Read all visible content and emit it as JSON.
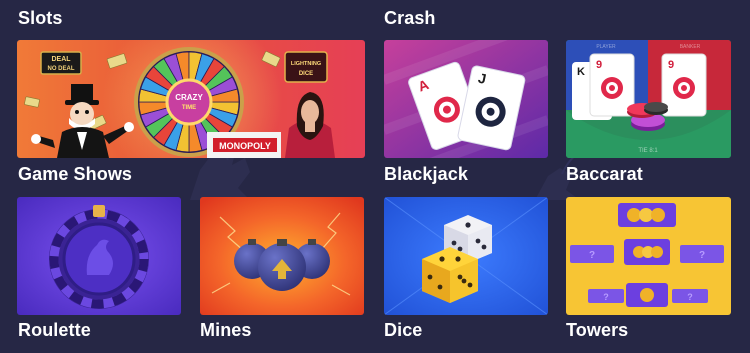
{
  "sections": {
    "slots": "Slots",
    "crash": "Crash"
  },
  "games": [
    {
      "key": "game-shows",
      "label": "Game Shows",
      "logo_deal": "DEAL",
      "logo_no_deal": "NO DEAL",
      "logo_crazy": "CRAZY",
      "logo_time": "TIME",
      "logo_lightning": "LIGHTNING",
      "logo_dice": "DICE",
      "logo_monopoly": "MONOPOLY",
      "icon": "wheel-of-fortune-icon"
    },
    {
      "key": "blackjack",
      "label": "Blackjack",
      "card1": "A",
      "card2": "J",
      "icon": "playing-cards-icon"
    },
    {
      "key": "baccarat",
      "label": "Baccarat",
      "card1": "K",
      "card2": "9",
      "card3": "9",
      "table_text": "TIE 8:1",
      "top_left": "PLAYER",
      "top_right": "BANKER",
      "icon": "poker-chips-icon"
    },
    {
      "key": "roulette",
      "label": "Roulette",
      "icon": "roulette-wheel-icon"
    },
    {
      "key": "mines",
      "label": "Mines",
      "icon": "bomb-icon"
    },
    {
      "key": "dice",
      "label": "Dice",
      "icon": "dice-icon"
    },
    {
      "key": "towers",
      "label": "Towers",
      "question": "?",
      "icon": "tower-coins-icon"
    }
  ],
  "colors": {
    "background": "#262745",
    "accent_purple": "#6a3fe0",
    "mines_orange": "#f25a1e",
    "dice_blue": "#2f6ef0",
    "towers_yellow": "#f6c430"
  }
}
